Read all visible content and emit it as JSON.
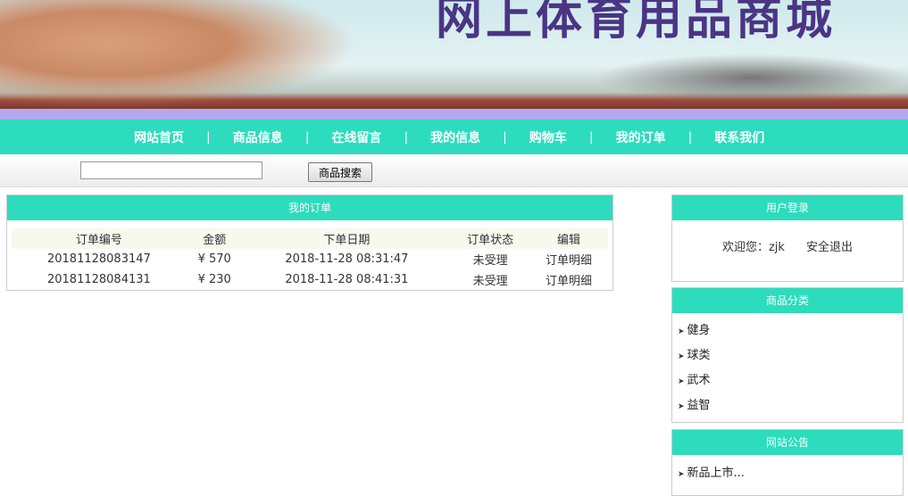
{
  "banner": {
    "title": "网上体育用品商城"
  },
  "nav": [
    "网站首页",
    "商品信息",
    "在线留言",
    "我的信息",
    "购物车",
    "我的订单",
    "联系我们"
  ],
  "search": {
    "value": "",
    "button": "商品搜索"
  },
  "orders": {
    "title": "我的订单",
    "columns": [
      "订单编号",
      "金额",
      "下单日期",
      "订单状态",
      "编辑"
    ],
    "rows": [
      [
        "20181128083147",
        "¥ 570",
        "2018-11-28 08:31:47",
        "未受理",
        "订单明细"
      ],
      [
        "20181128084131",
        "¥ 230",
        "2018-11-28 08:41:31",
        "未受理",
        "订单明细"
      ]
    ]
  },
  "login": {
    "title": "用户登录",
    "welcome": "欢迎您：zjk",
    "logout": "安全退出"
  },
  "categories": {
    "title": "商品分类",
    "items": [
      "健身",
      "球类",
      "武术",
      "益智"
    ]
  },
  "notice": {
    "title": "网站公告",
    "items": [
      "新品上市..."
    ]
  }
}
